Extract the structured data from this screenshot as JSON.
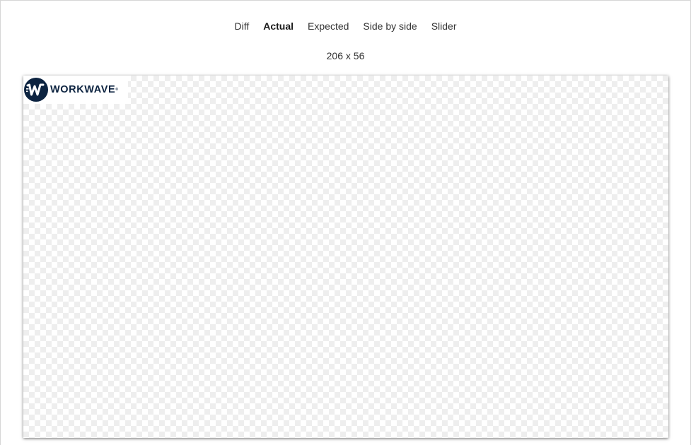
{
  "tabs": [
    {
      "label": "Diff",
      "active": false
    },
    {
      "label": "Actual",
      "active": true
    },
    {
      "label": "Expected",
      "active": false
    },
    {
      "label": "Side by side",
      "active": false
    },
    {
      "label": "Slider",
      "active": false
    }
  ],
  "image_dimensions": "206 x 56",
  "logo": {
    "text": "WORKWAVE",
    "registered_mark": "®",
    "icon": "workwave-logo-icon",
    "brand_color": "#0c2340"
  },
  "colors": {
    "text": "#333333",
    "active_text": "#1a1a1a",
    "checker_light": "#ffffff",
    "checker_dark": "#eeeeee"
  }
}
